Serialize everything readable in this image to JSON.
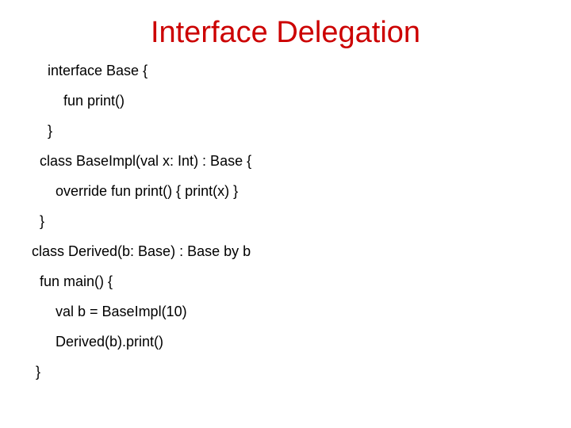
{
  "title": "Interface Delegation",
  "code": {
    "l1": "interface Base {",
    "l2": "fun print()",
    "l3": "}",
    "l4": "class BaseImpl(val x: Int) : Base {",
    "l5": "override fun print() { print(x) }",
    "l6": "}",
    "l7": "class Derived(b: Base) : Base by b",
    "l8": "fun main() {",
    "l9": "val b = BaseImpl(10)",
    "l10": "Derived(b).print()",
    "l11": "}"
  }
}
